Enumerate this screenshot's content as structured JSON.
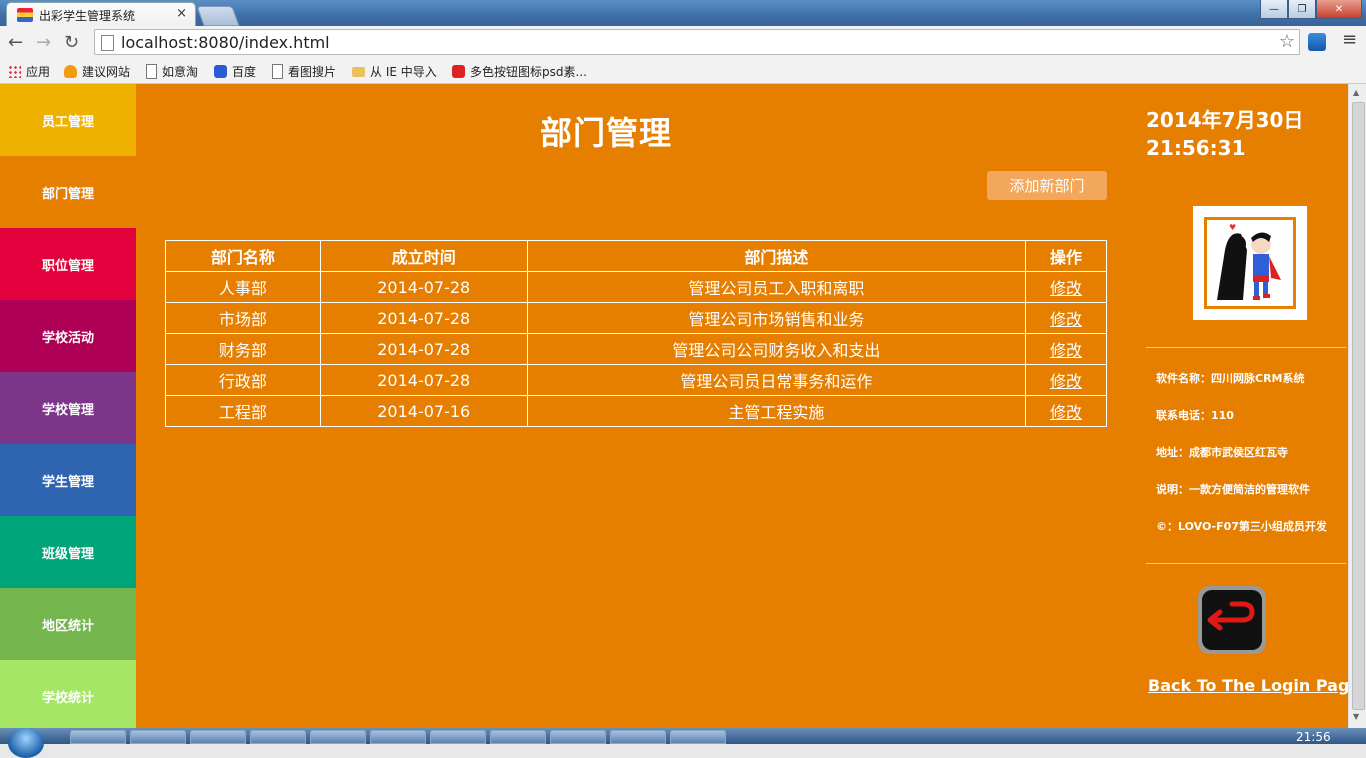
{
  "browser": {
    "tab_title": "出彩学生管理系统",
    "tab_close": "×",
    "url": "localhost:8080/index.html",
    "window_buttons": [
      "—",
      "❐",
      "✕"
    ],
    "bookmarks": [
      {
        "label": "应用",
        "icon": "apps-icon"
      },
      {
        "label": "建议网站",
        "icon": "bulb-icon"
      },
      {
        "label": "如意淘",
        "icon": "page-icon"
      },
      {
        "label": "百度",
        "icon": "baidu-paw-icon"
      },
      {
        "label": "看图搜片",
        "icon": "page-icon"
      },
      {
        "label": "从 IE 中导入",
        "icon": "folder-icon"
      },
      {
        "label": "多色按钮图标psd素...",
        "icon": "red-badge-icon"
      }
    ]
  },
  "sidebar": {
    "items": [
      {
        "label": "员工管理",
        "color": "#efb100"
      },
      {
        "label": "部门管理",
        "color": "#e67e00"
      },
      {
        "label": "职位管理",
        "color": "#e2003d"
      },
      {
        "label": "学校活动",
        "color": "#ae0054"
      },
      {
        "label": "学校管理",
        "color": "#7d3589"
      },
      {
        "label": "学生管理",
        "color": "#2f64b0"
      },
      {
        "label": "班级管理",
        "color": "#00a479"
      },
      {
        "label": "地区统计",
        "color": "#74b54e"
      },
      {
        "label": "学校统计",
        "color": "#a5e765"
      }
    ]
  },
  "main": {
    "title": "部门管理",
    "add_button": "添加新部门",
    "table": {
      "headers": [
        "部门名称",
        "成立时间",
        "部门描述",
        "操作"
      ],
      "rows": [
        {
          "name": "人事部",
          "date": "2014-07-28",
          "desc": "管理公司员工入职和离职",
          "action": "修改"
        },
        {
          "name": "市场部",
          "date": "2014-07-28",
          "desc": "管理公司市场销售和业务",
          "action": "修改"
        },
        {
          "name": "财务部",
          "date": "2014-07-28",
          "desc": "管理公司公司财务收入和支出",
          "action": "修改"
        },
        {
          "name": "行政部",
          "date": "2014-07-28",
          "desc": "管理公司员日常事务和运作",
          "action": "修改"
        },
        {
          "name": "工程部",
          "date": "2014-07-16",
          "desc": "主管工程实施",
          "action": "修改"
        }
      ]
    }
  },
  "right_panel": {
    "date": "2014年7月30日",
    "time": "21:56:31",
    "info": [
      "软件名称：四川网脉CRM系统",
      "联系电话：110",
      "地址：成都市武侯区红瓦寺",
      "说明：一款方便简洁的管理软件",
      "©：LOVO-F07第三小组成员开发"
    ],
    "back_link": "Back To The Login Page"
  },
  "taskbar": {
    "clock": "21:56"
  },
  "colors": {
    "page_bg": "#e67e00",
    "add_button_bg": "#f2a75c"
  }
}
